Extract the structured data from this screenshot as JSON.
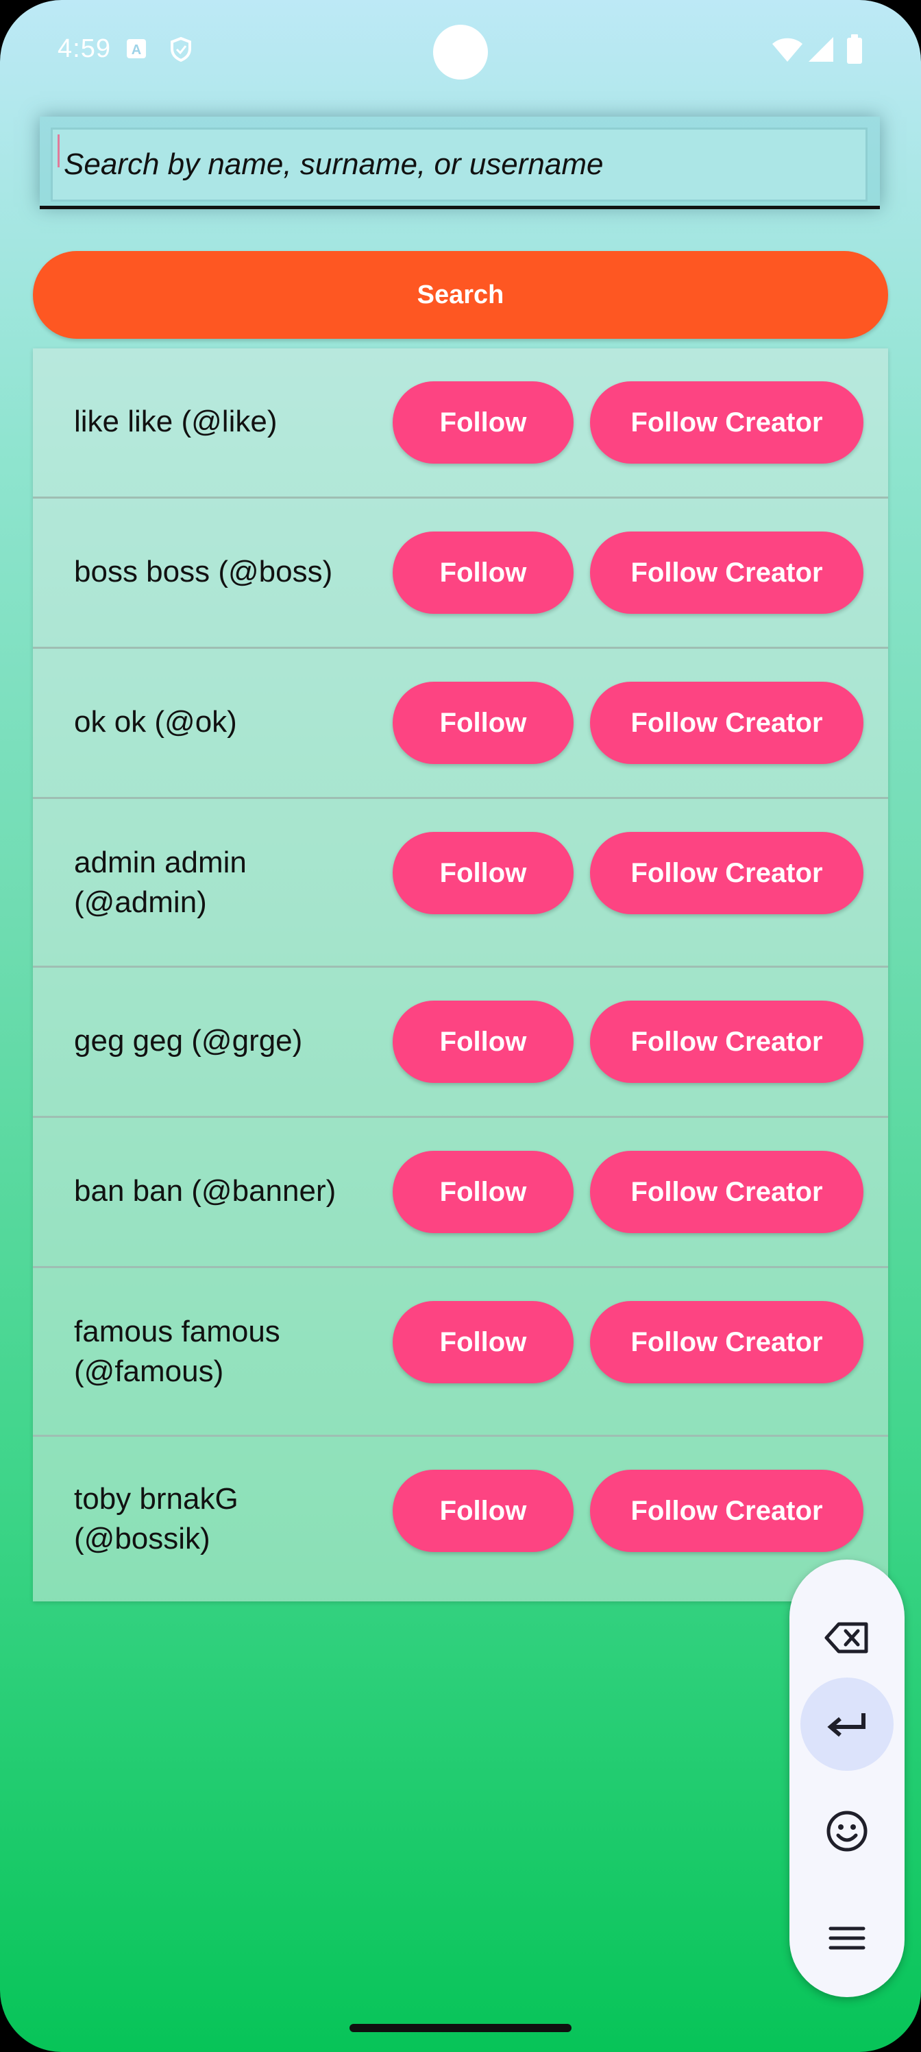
{
  "status_bar": {
    "time": "4:59",
    "left_icons": [
      "keyboard-a-icon",
      "shield-icon"
    ],
    "right_icons": [
      "wifi-icon",
      "signal-icon",
      "battery-icon"
    ]
  },
  "search": {
    "placeholder": "Search by name, surname, or username",
    "value": "",
    "button_label": "Search"
  },
  "users": [
    {
      "display": "like like (@like)",
      "follow_label": "Follow",
      "follow_creator_label": "Follow Creator"
    },
    {
      "display": "boss boss (@boss)",
      "follow_label": "Follow",
      "follow_creator_label": "Follow Creator"
    },
    {
      "display": "ok ok (@ok)",
      "follow_label": "Follow",
      "follow_creator_label": "Follow Creator"
    },
    {
      "display": "admin admin (@admin)",
      "follow_label": "Follow",
      "follow_creator_label": "Follow Creator"
    },
    {
      "display": "geg geg (@grge)",
      "follow_label": "Follow",
      "follow_creator_label": "Follow Creator"
    },
    {
      "display": "ban ban (@banner)",
      "follow_label": "Follow",
      "follow_creator_label": "Follow Creator"
    },
    {
      "display": "famous famous (@famous)",
      "follow_label": "Follow",
      "follow_creator_label": "Follow Creator"
    },
    {
      "display": "toby brnakG (@bossik)",
      "follow_label": "Follow",
      "follow_creator_label": "Follow Creator"
    }
  ],
  "keyboard_toolbar": {
    "items": [
      "backspace-icon",
      "enter-icon",
      "emoji-icon",
      "menu-icon"
    ],
    "active_item": "enter-icon"
  },
  "colors": {
    "search_button": "#fe5722",
    "follow_button": "#fd4482",
    "gradient_top": "#bde9f6",
    "gradient_bottom": "#07c458"
  }
}
